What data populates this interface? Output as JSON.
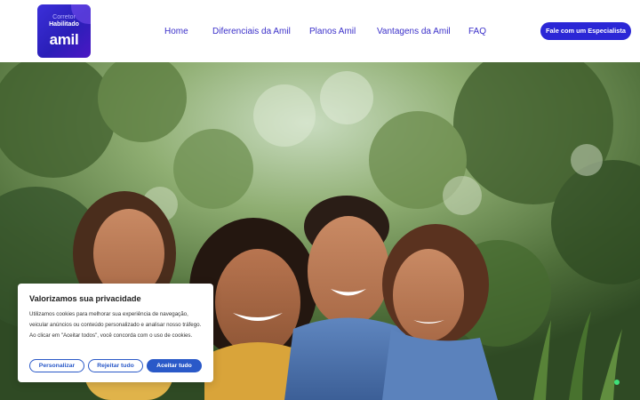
{
  "header": {
    "logo": {
      "line1": "Corretor",
      "line2": "Habilitado",
      "line3": "amil"
    },
    "nav": [
      {
        "label": "Home"
      },
      {
        "label": "Diferenciais da Amil"
      },
      {
        "label": "Planos Amil"
      },
      {
        "label": "Vantagens da Amil"
      },
      {
        "label": "FAQ"
      }
    ],
    "cta_label": "Fale com um Especialista"
  },
  "hero": {
    "image": "family-photo-outdoors"
  },
  "cookie_banner": {
    "title": "Valorizamos sua privacidade",
    "body": "Utilizamos cookies para melhorar sua experiência de navegação, veicular anúncios ou conteúdo personalizado e analisar nosso tráfego. Ao clicar em \"Aceitar todos\", você concorda com o uso de cookies.",
    "customize_label": "Personalizar",
    "reject_label": "Rejeitar tudo",
    "accept_label": "Aceitar tudo"
  },
  "colors": {
    "brand": "#2b27d6",
    "nav_text": "#3a2fc9",
    "cookie_button": "#2a59c8",
    "status_dot": "#3ee07a"
  }
}
